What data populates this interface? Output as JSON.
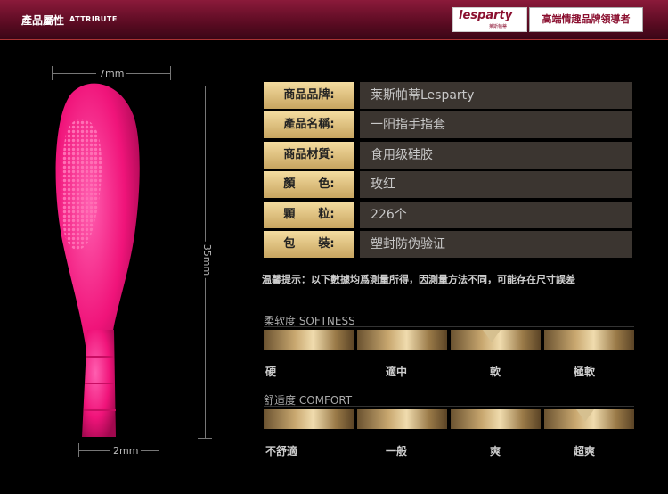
{
  "header": {
    "title_cn": "產品屬性",
    "title_en": "ATTRIBUTE",
    "logo_name": "lesparty",
    "logo_sub": "莱斯帕蒂",
    "tagline": "高端情趣品牌領導者"
  },
  "dimensions": {
    "top_width": "7mm",
    "height": "35mm",
    "bottom_width": "2mm"
  },
  "specs": [
    {
      "label": "商品品牌:",
      "value": "莱斯帕蒂Lesparty"
    },
    {
      "label": "產品名稱:",
      "value": "一阳指手指套"
    },
    {
      "label": "商品材質:",
      "value": "食用级硅胶"
    },
    {
      "label": "顏　　色:",
      "value": "玫红"
    },
    {
      "label": "顆　　粒:",
      "value": "226个"
    },
    {
      "label": "包　　裝:",
      "value": "塑封防伪验证"
    }
  ],
  "note": "温馨提示：以下數據均爲測量所得，因測量方法不同，可能存在尺寸誤差",
  "softness": {
    "title": "柔软度 SOFTNESS",
    "ticks": [
      "硬",
      "適中",
      "軟",
      "極軟"
    ],
    "selected_index": 2
  },
  "comfort": {
    "title": "舒适度 COMFORT",
    "ticks": [
      "不舒適",
      "一般",
      "爽",
      "超爽"
    ],
    "selected_index": 3
  },
  "colors": {
    "product": "#f0147a",
    "header": "#6e1030",
    "gold": "#d6b77a"
  }
}
